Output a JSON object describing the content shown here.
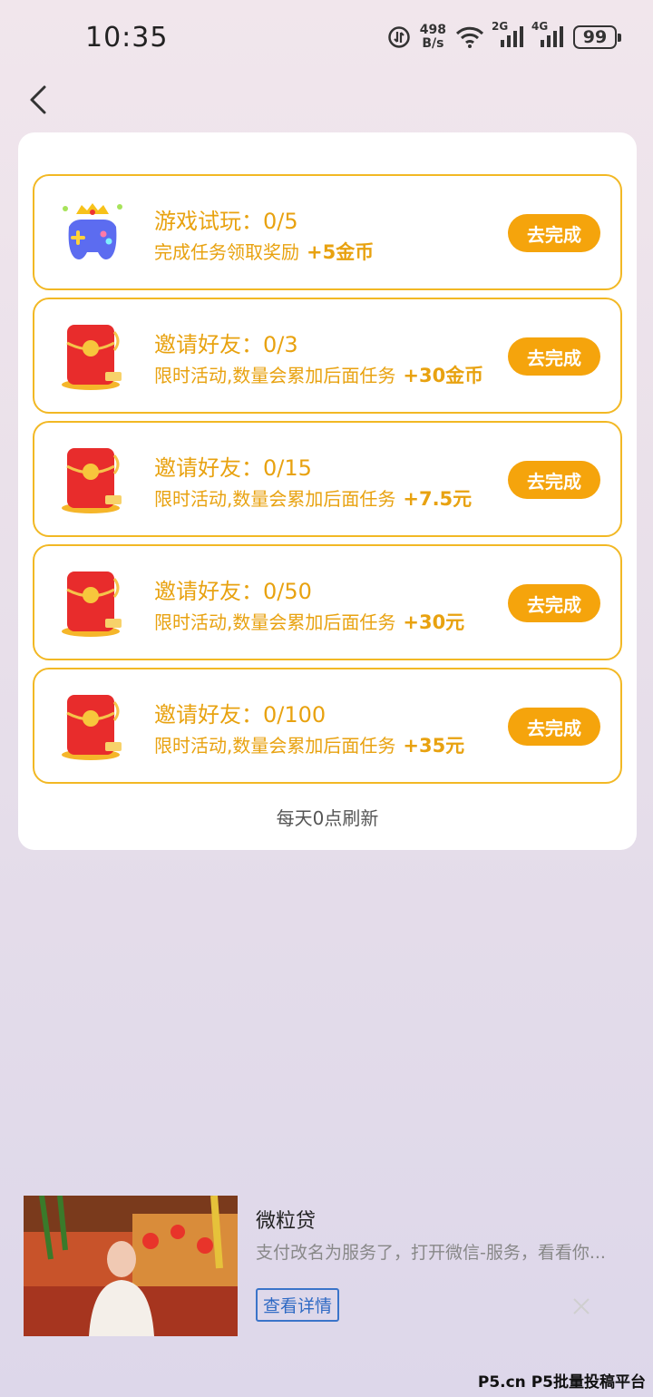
{
  "status_bar": {
    "time": "10:35",
    "net_speed_value": "498",
    "net_speed_unit": "B/s",
    "sim1": "2G",
    "sim2": "4G",
    "battery": "99"
  },
  "tasks": [
    {
      "title": "游戏试玩：0/5",
      "desc": "完成任务领取奖励",
      "reward": "+5金币",
      "button": "去完成",
      "icon": "gamepad-icon"
    },
    {
      "title": "邀请好友：0/3",
      "desc": "限时活动,数量会累加后面任务",
      "reward": "+30金币",
      "button": "去完成",
      "icon": "red-envelope-icon"
    },
    {
      "title": "邀请好友：0/15",
      "desc": "限时活动,数量会累加后面任务",
      "reward": "+7.5元",
      "button": "去完成",
      "icon": "red-envelope-icon"
    },
    {
      "title": "邀请好友：0/50",
      "desc": "限时活动,数量会累加后面任务",
      "reward": "+30元",
      "button": "去完成",
      "icon": "red-envelope-icon"
    },
    {
      "title": "邀请好友：0/100",
      "desc": "限时活动,数量会累加后面任务",
      "reward": "+35元",
      "button": "去完成",
      "icon": "red-envelope-icon"
    }
  ],
  "refresh_note": "每天0点刷新",
  "ad": {
    "title": "微粒贷",
    "desc": "支付改名为服务了，打开微信-服务，看看你...",
    "button": "查看详情"
  },
  "watermark": "P5.cn P5批量投稿平台",
  "colors": {
    "accent": "#f5a40c",
    "text_accent": "#e8a210",
    "border": "#f2b824",
    "ad_link": "#2f6ac4"
  }
}
